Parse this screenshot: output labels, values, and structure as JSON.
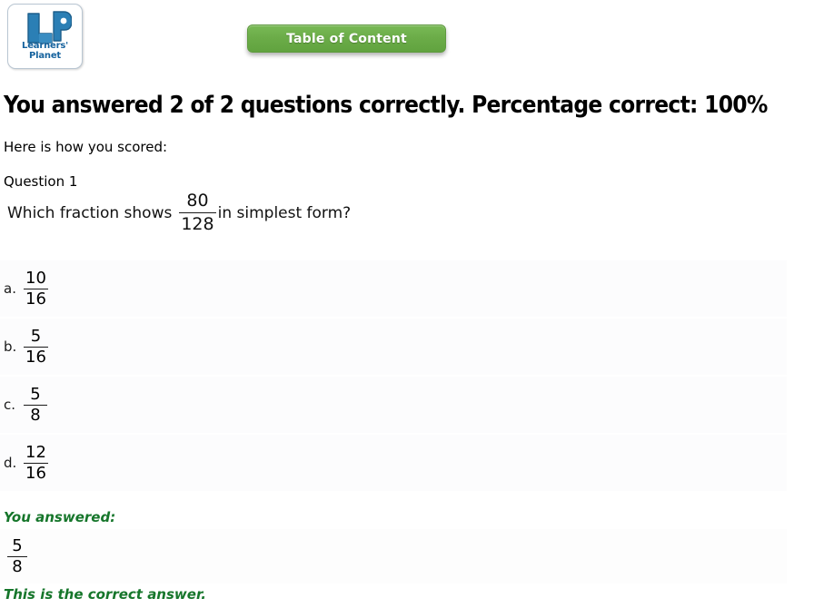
{
  "header": {
    "logo": {
      "mark_text": "LP",
      "caption": "Learners' Planet",
      "brand_color": "#2a7fb8"
    },
    "toc_button": {
      "label": "Table of Content",
      "color": "#6cb04a"
    }
  },
  "result": {
    "heading": "You answered 2 of 2 questions correctly. Percentage correct: 100%",
    "correct_count": 2,
    "total_count": 2,
    "percentage": "100%",
    "scored_intro": "Here is how you scored:"
  },
  "question": {
    "label": "Question 1",
    "stem_pre": "Which fraction shows",
    "stem_fraction": {
      "numerator": "80",
      "denominator": "128"
    },
    "stem_post": "in simplest form?",
    "options": [
      {
        "letter": "a.",
        "numerator": "10",
        "denominator": "16"
      },
      {
        "letter": "b.",
        "numerator": "5",
        "denominator": "16"
      },
      {
        "letter": "c.",
        "numerator": "5",
        "denominator": "8"
      },
      {
        "letter": "d.",
        "numerator": "12",
        "denominator": "16"
      }
    ]
  },
  "feedback": {
    "answered_label": "You answered:",
    "answered_fraction": {
      "numerator": "5",
      "denominator": "8"
    },
    "correct_note": "This is the correct answer.",
    "color": "#16762b"
  }
}
